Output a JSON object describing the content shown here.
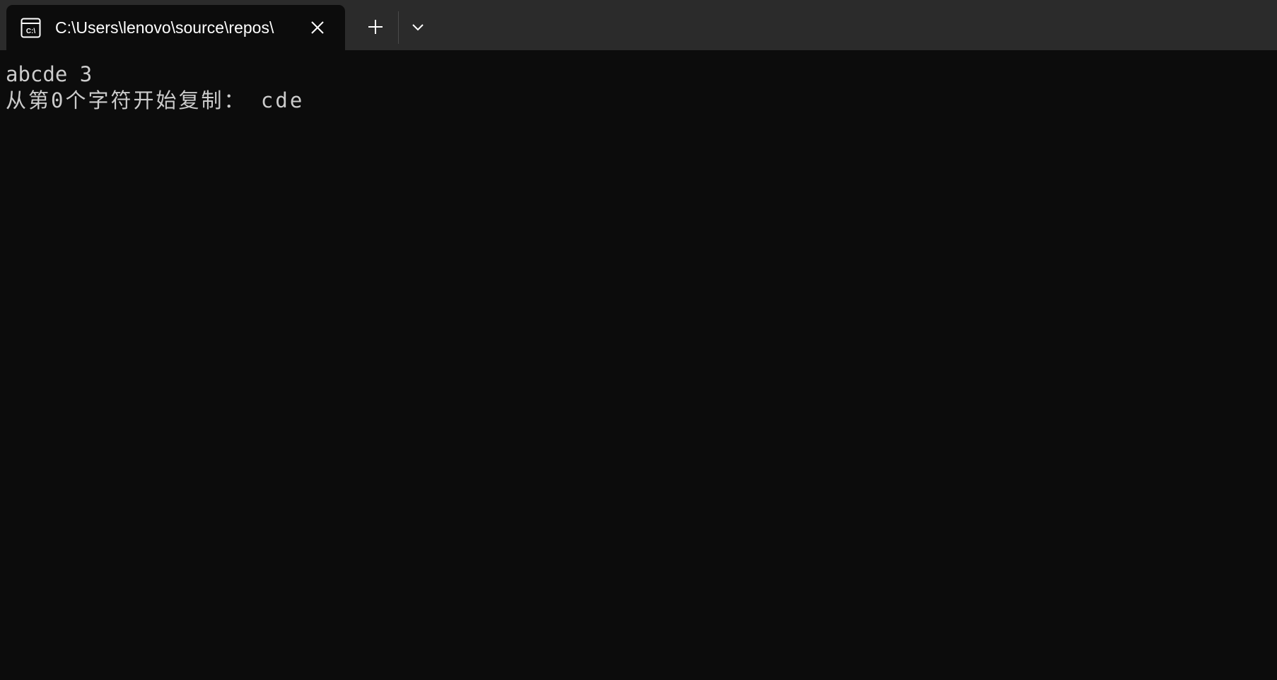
{
  "tab": {
    "icon": "console-icon",
    "title": "C:\\Users\\lenovo\\source\\repos\\"
  },
  "controls": {
    "close_icon": "close-icon",
    "new_tab_icon": "plus-icon",
    "dropdown_icon": "chevron-down-icon"
  },
  "console": {
    "lines": [
      "abcde 3",
      "从第0个字符开始复制： cde"
    ]
  },
  "colors": {
    "tabbar_bg": "#2b2b2b",
    "console_bg": "#0c0c0c",
    "console_text": "#cccccc",
    "tab_text": "#ffffff"
  }
}
